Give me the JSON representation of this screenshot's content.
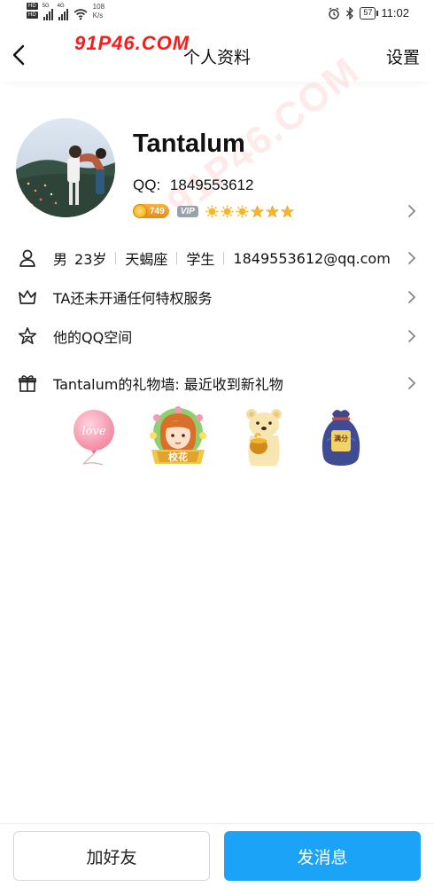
{
  "status_bar": {
    "network_1": "HD",
    "network_2": "HD",
    "gen_1": "5G",
    "gen_2": "4G",
    "speed_value": "108",
    "speed_unit": "K/s",
    "battery": "57",
    "time": "11:02",
    "icons": [
      "alarm-icon",
      "bluetooth-icon",
      "battery-icon",
      "wifi-icon",
      "signal-icon"
    ]
  },
  "nav": {
    "title": "个人资料",
    "settings_label": "设置"
  },
  "profile": {
    "name": "Tantalum",
    "qq_label": "QQ:",
    "qq_number": "1849553612",
    "coin_count": "749",
    "vip_label": "VIP",
    "level_icons": [
      "sun",
      "sun",
      "sun",
      "star",
      "star",
      "star"
    ]
  },
  "info": {
    "gender": "男",
    "age": "23岁",
    "zodiac": "天蝎座",
    "occupation": "学生",
    "email": "1849553612@qq.com"
  },
  "privilege_row": {
    "label": "TA还未开通任何特权服务"
  },
  "qzone_row": {
    "label": "他的QQ空间"
  },
  "gift_row": {
    "label": "Tantalum的礼物墙: 最近收到新礼物",
    "gifts": [
      {
        "icon": "love-balloon-icon",
        "text": "love"
      },
      {
        "icon": "school-belle-icon",
        "text": "校花"
      },
      {
        "icon": "honey-bear-icon",
        "text": ""
      },
      {
        "icon": "full-marks-bag-icon",
        "text": "满分"
      }
    ]
  },
  "actions": {
    "add_friend": "加好友",
    "send_message": "发消息"
  },
  "watermark": {
    "text": "91P46.COM",
    "faint_text": "91P46.COM"
  },
  "colors": {
    "primary_button": "#1aa3f7",
    "watermark": "#ff1919",
    "coin": "#f0a012"
  }
}
